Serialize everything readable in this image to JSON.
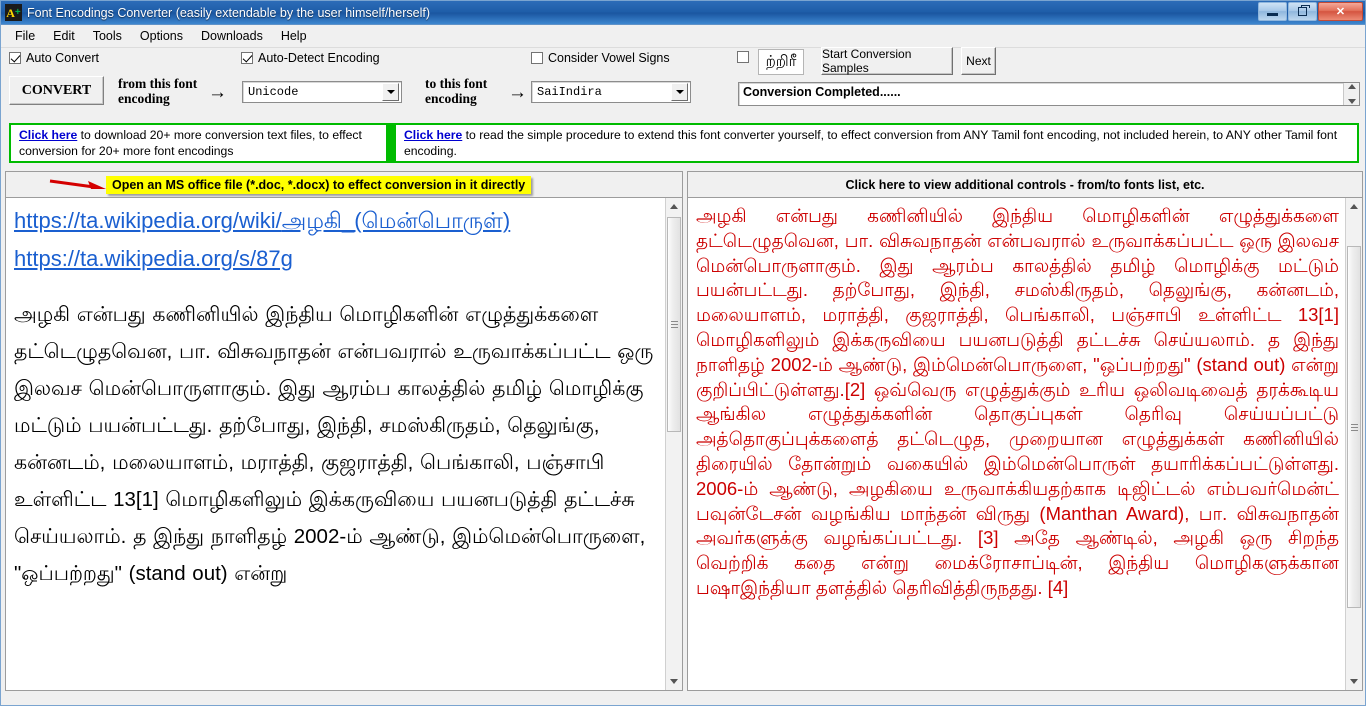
{
  "window": {
    "title": "Font Encodings Converter (easily extendable by the user himself/herself)",
    "icon": "app-icon-A-plus",
    "minimize_label": "–",
    "maximize_label": "❐",
    "close_label": "✕"
  },
  "menu": {
    "items": [
      {
        "label": "File"
      },
      {
        "label": "Edit"
      },
      {
        "label": "Tools"
      },
      {
        "label": "Options"
      },
      {
        "label": "Downloads"
      },
      {
        "label": "Help"
      }
    ]
  },
  "checkboxes": [
    {
      "label": "Auto Convert",
      "checked": true
    },
    {
      "label": "Auto-Detect Encoding",
      "checked": true
    },
    {
      "label": "Consider Vowel Signs",
      "checked": false
    },
    {
      "label": "",
      "checked": false
    }
  ],
  "toolbar": {
    "convert_label": "CONVERT",
    "from_label_line1": "from this font",
    "from_label_line2": "encoding",
    "to_label_line1": "to this font",
    "to_label_line2": "encoding",
    "arrow_glyph": "→",
    "from_encoding_value": "Unicode",
    "to_encoding_value": "SaiIndira",
    "tamil_sample": "ற்றிரீ",
    "start_samples_label": "Start Conversion Samples",
    "next_label": "Next",
    "status_text": "Conversion Completed......"
  },
  "info_panels": {
    "left": {
      "link_text": "Click here",
      "rest_text": " to download 20+ more conversion text files, to effect conversion for 20+ more font encodings"
    },
    "right": {
      "link_text": "Click here",
      "rest_text": " to read the simple procedure to extend this font converter yourself, to effect conversion from ANY Tamil font encoding, not included herein, to ANY other Tamil font encoding."
    }
  },
  "headers": {
    "left_note": "Open an MS office file (*.doc, *.docx) to effect conversion in it directly",
    "left_arrow_icon": "red-arrow-icon",
    "right_note": "Click here to view additional controls - from/to fonts list, etc."
  },
  "editors": {
    "source": {
      "url1_prefix": "https://ta.wikipedia.org/wiki/",
      "url1_tamil": "அழகி_(மென்பொருள்)",
      "url2": "https://ta.wikipedia.org/s/87g",
      "body": "அழகி என்பது கணினியில் இந்திய மொழிகளின் எழுத்துக்களை தட்டெழுதவென, பா. விசுவநாதன் என்பவரால் உருவாக்கப்பட்ட ஒரு இலவச மென்பொருளாகும். இது ஆரம்ப காலத்தில் தமிழ் மொழிக்கு மட்டும் பயன்பட்டது. தற்போது, இந்தி, சமஸ்கிருதம், தெலுங்கு, கன்னடம், மலையாளம், மராத்தி, குஜராத்தி, பெங்காலி, பஞ்சாபி உள்ளிட்ட 13[1] மொழிகளிலும் இக்கருவியை பயனபடுத்தி தட்டச்சு செய்யலாம். த இந்து நாளிதழ் 2002-ம் ஆண்டு, இம்மென்பொருளை, \"ஒப்பற்றது\" (stand out) என்று"
    },
    "target": {
      "body": "அழகி என்பது கணினியில் இந்திய மொழிகளின் எழுத்துக்களை தட்டெழுதவென, பா. விசுவநாதன் என்பவரால் உருவாக்கப்பட்ட ஒரு இலவச மென்பொருளாகும். இது ஆரம்ப காலத்தில் தமிழ் மொழிக்கு மட்டும் பயன்பட்டது. தற்போது, இந்தி, சமஸ்கிருதம், தெலுங்கு, கன்னடம், மலையாளம், மராத்தி, குஜராத்தி, பெங்காலி, பஞ்சாபி உள்ளிட்ட 13[1] மொழிகளிலும் இக்கருவியை பயனபடுத்தி தட்டச்சு செய்யலாம். த இந்து நாளிதழ் 2002-ம் ஆண்டு, இம்மென்பொருளை, \"ஒப்பற்றது\" (stand out) என்று குறிப்பிட்டுள்ளது.[2] ஒவ்வெரு எழுத்துக்கும் உரிய ஒலிவடிவைத் தரக்கூடிய ஆங்கில எழுத்துக்களின் தொகுப்புகள் தெரிவு செய்யப்பட்டு அத்தொகுப்புக்களைத் தட்டெழுத, முறையான எழுத்துக்கள் கணினியில் திரையில் தோன்றும் வகையில் இம்மென்பொருள் தயாரிக்கப்பட்டுள்ளது. 2006-ம் ஆண்டு, அழகியை உருவாக்கியதற்காக டிஜிட்டல் எம்பவர்மென்ட் பவுன்டேசன் வழங்கிய மாந்தன் விருது (Manthan Award), பா. விசுவநாதன் அவர்களுக்கு வழங்கப்பட்டது. [3] அதே ஆண்டில், அழகி ஒரு சிறந்த வெற்றிக் கதை என்று மைக்ரோசாப்டின், இந்திய மொழிகளுக்கான பஷாஇந்தியா தளத்தில் தெரிவித்திருநதது. [4]"
    }
  },
  "colors": {
    "titlebar_blue": "#1e5da8",
    "green_border": "#00bb00",
    "yellow_note": "#ffff00",
    "link_blue": "#1a5fd0",
    "target_text_red": "#cc0000",
    "arrow_red": "#d40000"
  }
}
